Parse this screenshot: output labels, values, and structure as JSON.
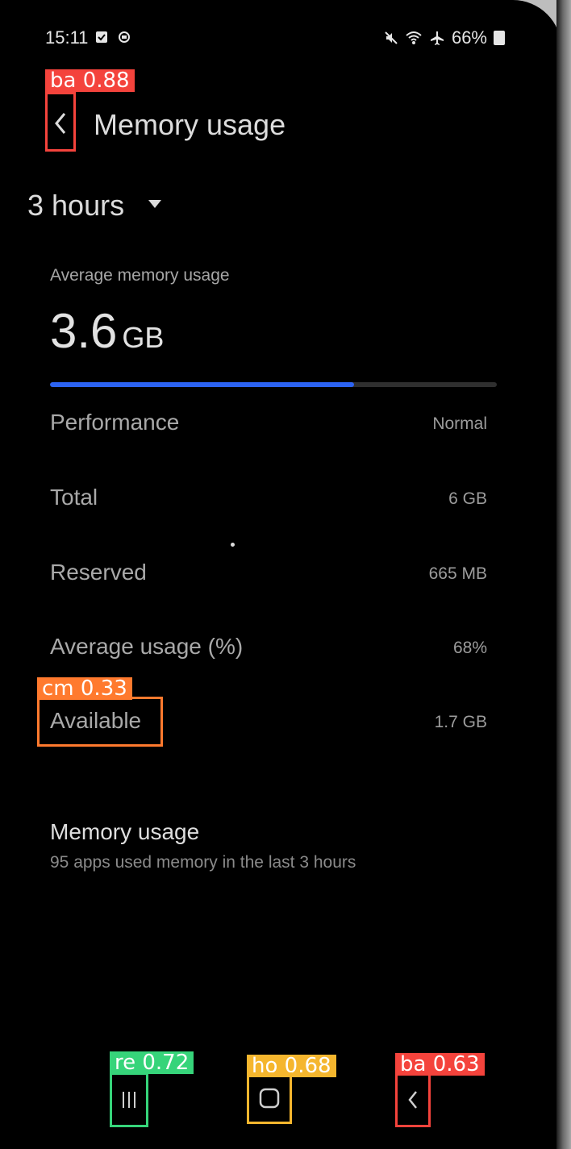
{
  "status_bar": {
    "time": "15:11",
    "battery": "66%",
    "icons": [
      "checkbox-icon",
      "circle-icon",
      "mute-icon",
      "wifi-icon",
      "airplane-icon",
      "battery-icon"
    ]
  },
  "header": {
    "back_icon": "chevron-left-icon",
    "title": "Memory usage"
  },
  "period_selector": {
    "value": "3 hours",
    "icon": "caret-down-icon"
  },
  "summary": {
    "label": "Average memory usage",
    "value": "3.6",
    "unit": "GB",
    "usage_fraction": 0.68,
    "bar_color": "#2c63f2"
  },
  "details": [
    {
      "label": "Performance",
      "value": "Normal"
    },
    {
      "label": "Total",
      "value": "6 GB"
    },
    {
      "label": "Reserved",
      "value": "665 MB"
    },
    {
      "label": "Average usage (%)",
      "value": "68%"
    },
    {
      "label": "Available",
      "value": "1.7 GB"
    }
  ],
  "memory_section": {
    "title": "Memory usage",
    "subtitle": "95 apps used memory in the last 3 hours"
  },
  "detections": {
    "header_back": "ba 0.88",
    "available": "cm 0.33",
    "nav_recent": "re 0.72",
    "nav_home": "ho 0.68",
    "nav_back": "ba 0.63"
  },
  "nav_bar": {
    "icons": [
      "recent-apps-icon",
      "home-icon",
      "back-icon"
    ]
  }
}
